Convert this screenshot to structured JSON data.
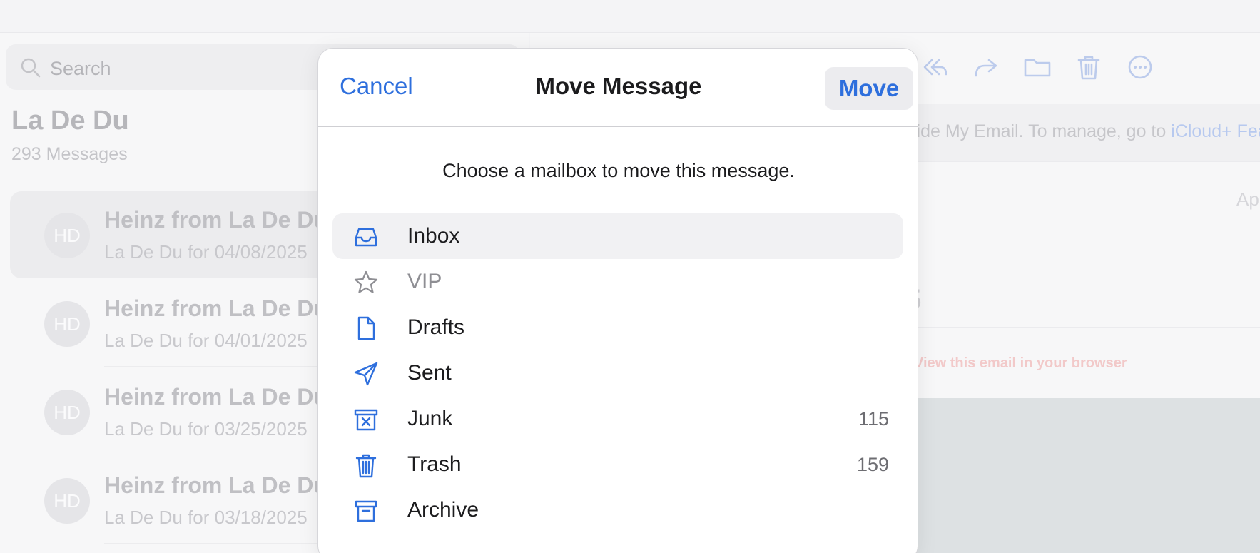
{
  "sidebar": {
    "search_placeholder": "Search",
    "mailbox_title": "La De Du",
    "message_count": "293 Messages",
    "messages": [
      {
        "initials": "HD",
        "from": "Heinz from La De Du",
        "subject": "La De Du for 04/08/2025"
      },
      {
        "initials": "HD",
        "from": "Heinz from La De Du",
        "subject": "La De Du for 04/01/2025"
      },
      {
        "initials": "HD",
        "from": "Heinz from La De Du",
        "subject": "La De Du for 03/25/2025"
      },
      {
        "initials": "HD",
        "from": "Heinz from La De Du",
        "subject": "La De Du for 03/18/2025"
      }
    ]
  },
  "detail": {
    "toolbar_icons": [
      "reply-all-icon",
      "forward-icon",
      "folder-icon",
      "trash-icon",
      "more-icon"
    ],
    "banner_text": "lide My Email. To manage, go to ",
    "banner_link": "iCloud+ Fea",
    "date_fragment": "Ap",
    "heading_fragment": "5",
    "view_link": "View this email in your browser"
  },
  "modal": {
    "cancel_label": "Cancel",
    "title": "Move Message",
    "move_label": "Move",
    "prompt": "Choose a mailbox to move this message.",
    "mailboxes": [
      {
        "label": "Inbox",
        "icon": "inbox-tray-icon",
        "count": "",
        "highlighted": true,
        "disabled": false
      },
      {
        "label": "VIP",
        "icon": "star-icon",
        "count": "",
        "highlighted": false,
        "disabled": true
      },
      {
        "label": "Drafts",
        "icon": "document-icon",
        "count": "",
        "highlighted": false,
        "disabled": false
      },
      {
        "label": "Sent",
        "icon": "paper-plane-icon",
        "count": "",
        "highlighted": false,
        "disabled": false
      },
      {
        "label": "Junk",
        "icon": "junk-bin-icon",
        "count": "115",
        "highlighted": false,
        "disabled": false
      },
      {
        "label": "Trash",
        "icon": "trash-icon",
        "count": "159",
        "highlighted": false,
        "disabled": false
      },
      {
        "label": "Archive",
        "icon": "archive-box-icon",
        "count": "",
        "highlighted": false,
        "disabled": false
      }
    ]
  },
  "colors": {
    "accent": "#2e6fdd",
    "disabled_icon": "#8e8e93"
  }
}
